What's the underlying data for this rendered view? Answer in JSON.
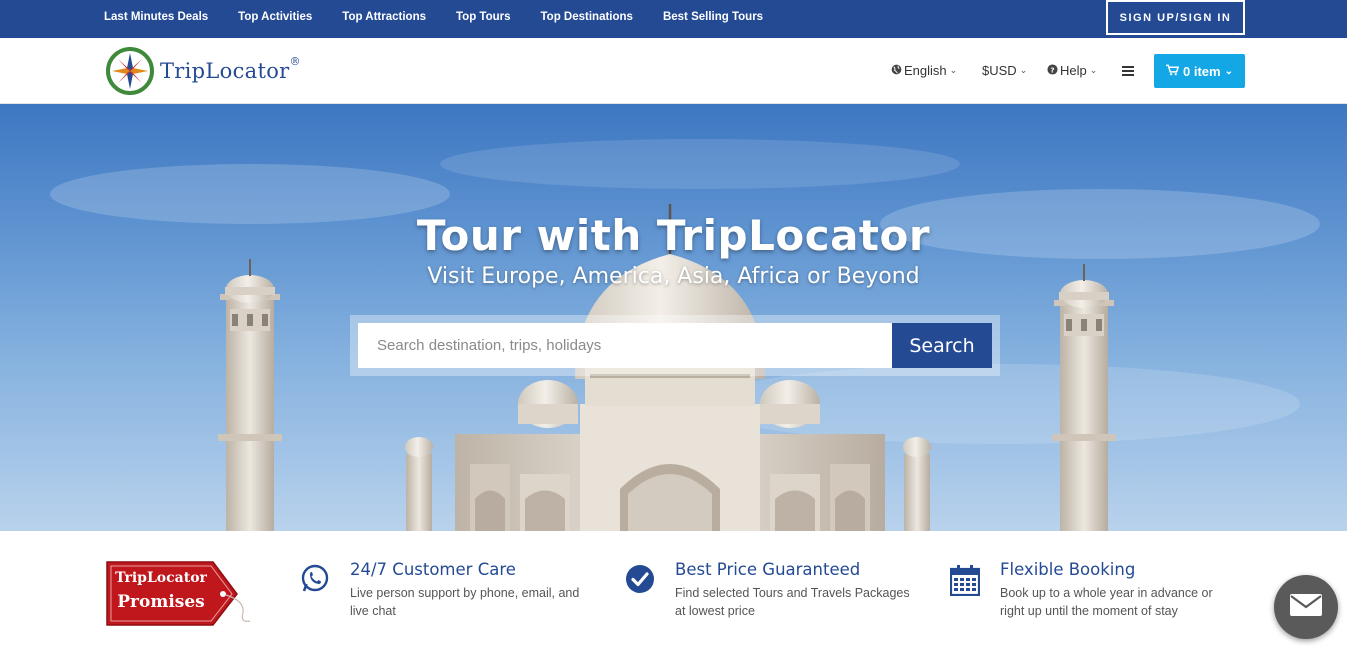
{
  "topbar": {
    "links": [
      "Last Minutes Deals",
      "Top Activities",
      "Top Attractions",
      "Top Tours",
      "Top Destinations",
      "Best Selling Tours"
    ],
    "signin_label": "SIGN UP/SIGN IN"
  },
  "header": {
    "logo_text": "TripLocator",
    "logo_mark": "®",
    "language": "English",
    "currency": "$USD",
    "help": "Help",
    "cart_label": "0 item",
    "icons": [
      "globe-icon",
      "question-circle-icon",
      "hamburger-menu-icon",
      "shopping-cart-icon",
      "chevron-down-icon"
    ]
  },
  "hero": {
    "title": "Tour with TripLocator",
    "subtitle": "Visit Europe, America, Asia, Africa or Beyond",
    "search_placeholder": "Search destination, trips, holidays",
    "search_button": "Search"
  },
  "promises": {
    "badge_line1": "TripLocator",
    "badge_line2": "Promises",
    "features": [
      {
        "icon": "whatsapp-icon",
        "title": "24/7 Customer Care",
        "desc": "Live person support by phone, email, and live chat"
      },
      {
        "icon": "check-circle-icon",
        "title": "Best Price Guaranteed",
        "desc": "Find selected Tours and Travels Packages at lowest price"
      },
      {
        "icon": "calendar-icon",
        "title": "Flexible Booking",
        "desc": "Book up to a whole year in advance or right up until the moment of stay"
      }
    ]
  },
  "colors": {
    "primary": "#244a94",
    "accent": "#13a7e6",
    "badge_red": "#c0171c"
  }
}
